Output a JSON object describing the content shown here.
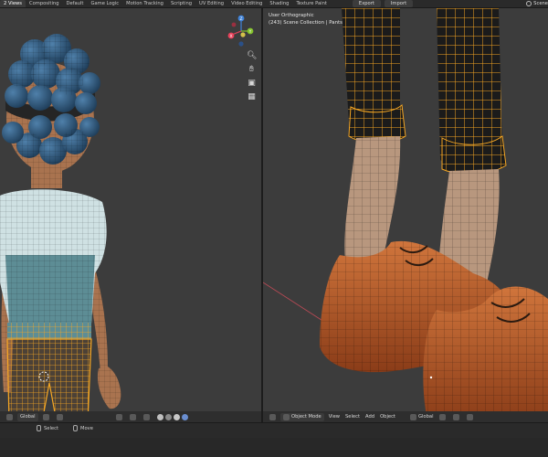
{
  "workspace_tabs": [
    {
      "label": "2 Views",
      "active": true
    },
    {
      "label": "Compositing",
      "active": false
    },
    {
      "label": "Default",
      "active": false
    },
    {
      "label": "Game Logic",
      "active": false
    },
    {
      "label": "Motion Tracking",
      "active": false
    },
    {
      "label": "Scripting",
      "active": false
    },
    {
      "label": "UV Editing",
      "active": false
    },
    {
      "label": "Video Editing",
      "active": false
    },
    {
      "label": "Shading",
      "active": false
    },
    {
      "label": "Texture Paint",
      "active": false
    }
  ],
  "toolbar": {
    "export_label": "Export",
    "import_label": "Import",
    "scene_label": "Scene"
  },
  "right_viewport": {
    "view_name": "User Orthographic",
    "collection_info": "(243) Scene Collection | Pants"
  },
  "left_header": {
    "transform_orientation": "Global"
  },
  "right_header": {
    "mode": "Object Mode",
    "menus": [
      "View",
      "Select",
      "Add",
      "Object"
    ],
    "transform_orientation": "Global"
  },
  "status": {
    "select_label": "Select",
    "move_label": "Move"
  },
  "gizmo": {
    "axis_z": "Z",
    "axis_y": "Y",
    "axis_x": "X"
  },
  "colors": {
    "axis_x": "#e8415a",
    "axis_y": "#84c22c",
    "axis_z": "#3f82d8",
    "wire_select": "#f5a623",
    "viewport_bg": "#3c3c3c",
    "skin": "#b07a57",
    "hair": "#2e5c80",
    "shoe": "#c4622f",
    "shirt_light": "#cfe1e3",
    "shirt_dark": "#5d8d95"
  },
  "icons": [
    "zoom-icon",
    "hand-pan-icon",
    "camera-icon",
    "grid-icon",
    "mouse-icon"
  ]
}
